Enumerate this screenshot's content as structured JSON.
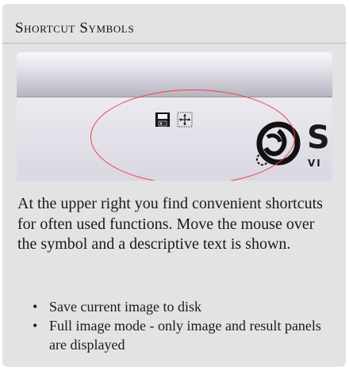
{
  "panel": {
    "title": "Shortcut Symbols"
  },
  "screenshot": {
    "icons": [
      "save-icon",
      "full-image-mode-icon"
    ],
    "logo_letters": "S(",
    "logo_subtext": "VI",
    "highlight_color": "#e04848"
  },
  "description": "At the upper right you find convenient shortcuts for often used functions. Move the mouse over the symbol and a descriptive text is shown.",
  "bullets": [
    "Save current image to disk",
    "Full image mode - only image and result panels are displayed"
  ],
  "bullet_char": "•",
  "colors": {
    "panel_background": "#e2e3e3",
    "text": "#1a1a1a",
    "highlight_ellipse": "#e04848"
  }
}
